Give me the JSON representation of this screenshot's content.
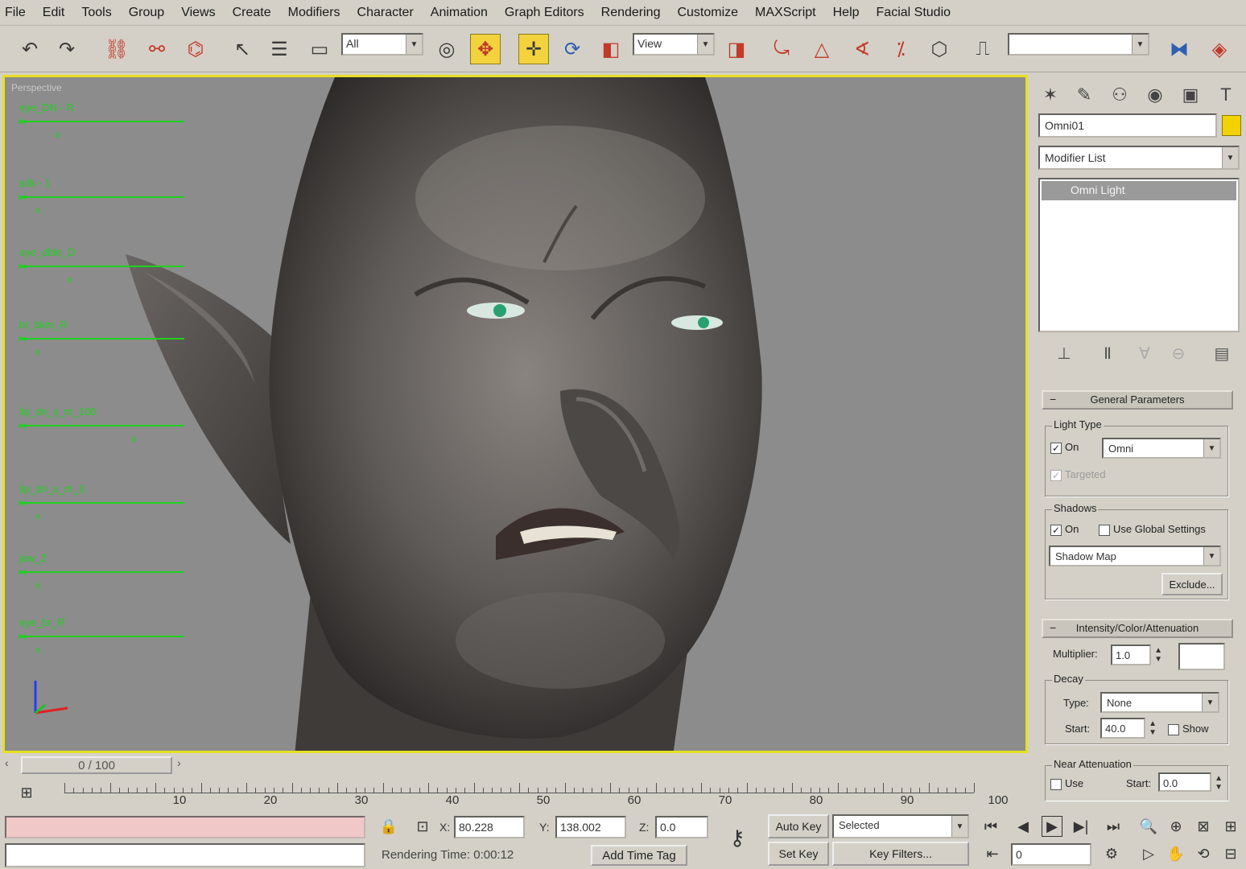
{
  "menu": [
    "File",
    "Edit",
    "Tools",
    "Group",
    "Views",
    "Create",
    "Modifiers",
    "Character",
    "Animation",
    "Graph Editors",
    "Rendering",
    "Customize",
    "MAXScript",
    "Help",
    "Facial Studio"
  ],
  "toolbar": {
    "selection_filter": "All",
    "reference_coord": "View",
    "named_selection": ""
  },
  "viewport": {
    "label": "Perspective",
    "controls": [
      {
        "name": "eye_DN - R",
        "knob_pos": 0.15
      },
      {
        "name": "sdk - 1",
        "knob_pos": 0.0
      },
      {
        "name": "eye_dble_D",
        "knob_pos": 0.25
      },
      {
        "name": "br_bkm_R",
        "knob_pos": 0.0
      },
      {
        "name": "lip_dn_s_m_100",
        "knob_pos": 0.75
      },
      {
        "name": "lip_dn_s_m_3",
        "knob_pos": 0.0
      },
      {
        "name": "jaw_2",
        "knob_pos": 0.0
      },
      {
        "name": "eye_br_R",
        "knob_pos": 0.0
      }
    ]
  },
  "command_panel": {
    "object_name": "Omni01",
    "modifier_list": "Modifier List",
    "stack_item": "Omni Light",
    "general": {
      "title": "General Parameters",
      "light_type_group": "Light Type",
      "on_label": "On",
      "light_type": "Omni",
      "targeted_label": "Targeted",
      "shadows_group": "Shadows",
      "shadows_on_label": "On",
      "use_global_label": "Use Global Settings",
      "shadow_type": "Shadow Map",
      "exclude_label": "Exclude..."
    },
    "intensity": {
      "title": "Intensity/Color/Attenuation",
      "multiplier_label": "Multiplier:",
      "multiplier": "1.0",
      "decay_group": "Decay",
      "type_label": "Type:",
      "type": "None",
      "start_label": "Start:",
      "start": "40.0",
      "show_label": "Show",
      "near_group": "Near Attenuation",
      "use_label": "Use",
      "near_start_label": "Start:",
      "near_start": "0.0"
    },
    "colors": {
      "swatch": "#f2d200"
    }
  },
  "timeline": {
    "frame": "0 / 100",
    "ticks": [
      "10",
      "20",
      "30",
      "40",
      "50",
      "60",
      "70",
      "80",
      "90",
      "100"
    ]
  },
  "status": {
    "x_label": "X:",
    "x": "80.228",
    "y_label": "Y:",
    "y": "138.002",
    "z_label": "Z:",
    "z": "0.0",
    "rendering_time": "Rendering Time: 0:00:12",
    "add_time_tag": "Add Time Tag",
    "auto_key": "Auto Key",
    "key_mode": "Selected",
    "set_key": "Set Key",
    "key_filters": "Key Filters...",
    "current_frame": "0"
  }
}
